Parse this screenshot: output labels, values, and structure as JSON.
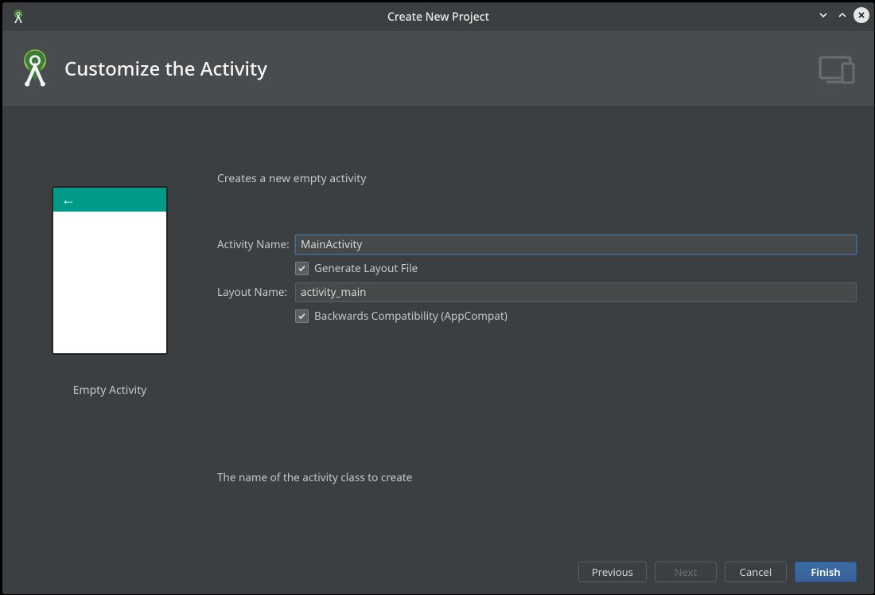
{
  "window": {
    "title": "Create New Project"
  },
  "header": {
    "title": "Customize the Activity"
  },
  "preview": {
    "label": "Empty Activity"
  },
  "form": {
    "intro": "Creates a new empty activity",
    "activity_name": {
      "label": "Activity Name:",
      "value": "MainActivity"
    },
    "generate_layout": {
      "label": "Generate Layout File",
      "checked": true
    },
    "layout_name": {
      "label": "Layout Name:",
      "value": "activity_main"
    },
    "backwards_compat": {
      "label": "Backwards Compatibility (AppCompat)",
      "checked": true
    },
    "hint": "The name of the activity class to create"
  },
  "footer": {
    "previous": "Previous",
    "next": "Next",
    "cancel": "Cancel",
    "finish": "Finish"
  }
}
